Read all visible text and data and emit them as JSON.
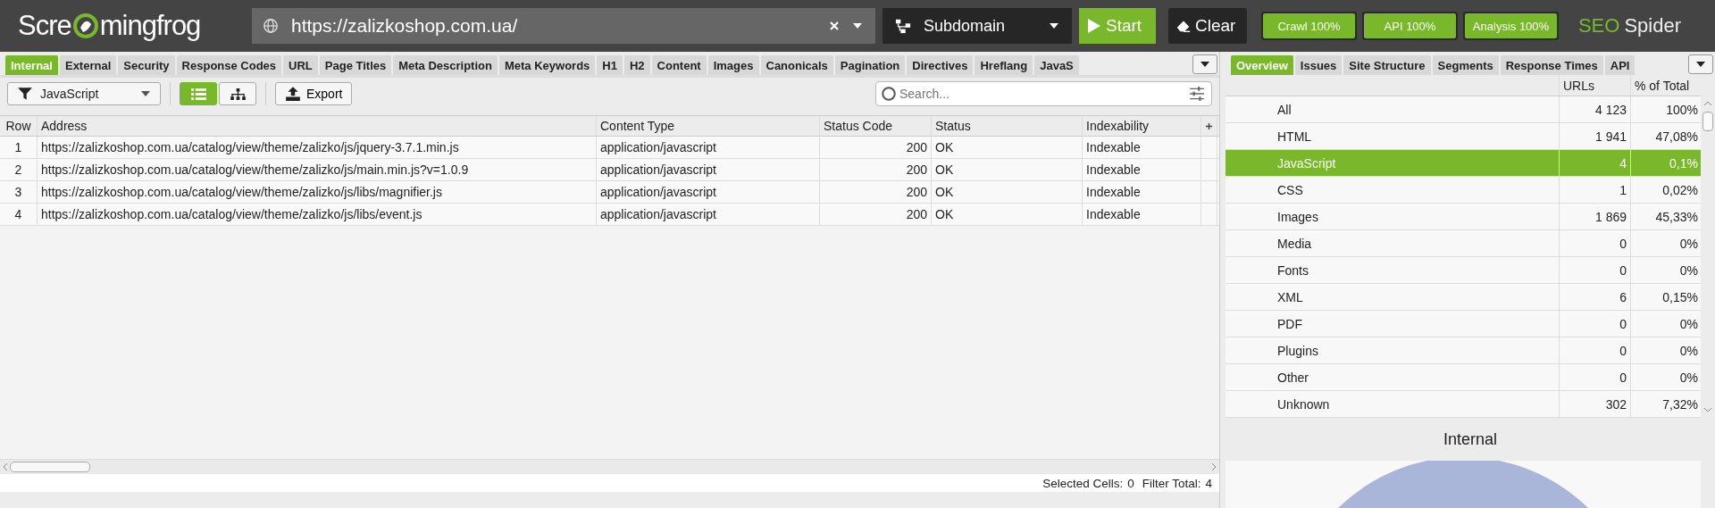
{
  "top_bar": {
    "logo": {
      "left": "Scre",
      "right": "mingfrog"
    },
    "url_field": {
      "value": "https://zalizkoshop.com.ua/"
    },
    "mode_dropdown": {
      "value": "Subdomain"
    },
    "start_button": "Start",
    "clear_button": "Clear",
    "progress": [
      {
        "label": "Crawl 100%",
        "level": 1
      },
      {
        "label": "API 100%",
        "level": 1
      },
      {
        "label": "Analysis 100%",
        "level": 1
      }
    ],
    "brand": {
      "first": "SEO",
      "second": "Spider"
    }
  },
  "left_tabs": [
    {
      "label": "Internal",
      "selected": true
    },
    {
      "label": "External",
      "selected": false
    },
    {
      "label": "Security",
      "selected": false
    },
    {
      "label": "Response Codes",
      "selected": false
    },
    {
      "label": "URL",
      "selected": false
    },
    {
      "label": "Page Titles",
      "selected": false
    },
    {
      "label": "Meta Description",
      "selected": false
    },
    {
      "label": "Meta Keywords",
      "selected": false
    },
    {
      "label": "H1",
      "selected": false
    },
    {
      "label": "H2",
      "selected": false
    },
    {
      "label": "Content",
      "selected": false
    },
    {
      "label": "Images",
      "selected": false
    },
    {
      "label": "Canonicals",
      "selected": false
    },
    {
      "label": "Pagination",
      "selected": false
    },
    {
      "label": "Directives",
      "selected": false
    },
    {
      "label": "Hreflang",
      "selected": false
    },
    {
      "label": "JavaS",
      "selected": false
    }
  ],
  "toolbar": {
    "filter": "JavaScript",
    "views": [
      {
        "kind": "list",
        "selected": true
      },
      {
        "kind": "tree",
        "selected": false
      }
    ],
    "export_button": "Export",
    "search": {
      "placeholder": "Search..."
    }
  },
  "table": {
    "columns": [
      "Row",
      "Address",
      "Content Type",
      "Status Code",
      "Status",
      "Indexability"
    ],
    "rows": [
      [
        "1",
        "https://zalizkoshop.com.ua/catalog/view/theme/zalizko/js/jquery-3.7.1.min.js",
        "application/javascript",
        "200",
        "OK",
        "Indexable"
      ],
      [
        "2",
        "https://zalizkoshop.com.ua/catalog/view/theme/zalizko/js/main.min.js?v=1.0.9",
        "application/javascript",
        "200",
        "OK",
        "Indexable"
      ],
      [
        "3",
        "https://zalizkoshop.com.ua/catalog/view/theme/zalizko/js/libs/magnifier.js",
        "application/javascript",
        "200",
        "OK",
        "Indexable"
      ],
      [
        "4",
        "https://zalizkoshop.com.ua/catalog/view/theme/zalizko/js/libs/event.js",
        "application/javascript",
        "200",
        "OK",
        "Indexable"
      ]
    ]
  },
  "status_bar": {
    "selected_label": "Selected Cells:",
    "selected_value": "0",
    "filter_label": "Filter Total:",
    "filter_value": "4"
  },
  "right_tabs": [
    {
      "label": "Overview",
      "selected": true
    },
    {
      "label": "Issues",
      "selected": false
    },
    {
      "label": "Site Structure",
      "selected": false
    },
    {
      "label": "Segments",
      "selected": false
    },
    {
      "label": "Response Times",
      "selected": false
    },
    {
      "label": "API",
      "selected": false
    }
  ],
  "overview": {
    "columns": [
      "URLs",
      "% of Total"
    ],
    "rows": [
      {
        "label": "All",
        "urls": "4 123",
        "percent": "100%",
        "selected": false
      },
      {
        "label": "HTML",
        "urls": "1 941",
        "percent": "47,08%",
        "selected": false
      },
      {
        "label": "JavaScript",
        "urls": "4",
        "percent": "0,1%",
        "selected": true
      },
      {
        "label": "CSS",
        "urls": "1",
        "percent": "0,02%",
        "selected": false
      },
      {
        "label": "Images",
        "urls": "1 869",
        "percent": "45,33%",
        "selected": false
      },
      {
        "label": "Media",
        "urls": "0",
        "percent": "0%",
        "selected": false
      },
      {
        "label": "Fonts",
        "urls": "0",
        "percent": "0%",
        "selected": false
      },
      {
        "label": "XML",
        "urls": "6",
        "percent": "0,15%",
        "selected": false
      },
      {
        "label": "PDF",
        "urls": "0",
        "percent": "0%",
        "selected": false
      },
      {
        "label": "Plugins",
        "urls": "0",
        "percent": "0%",
        "selected": false
      },
      {
        "label": "Other",
        "urls": "0",
        "percent": "0%",
        "selected": false
      },
      {
        "label": "Unknown",
        "urls": "302",
        "percent": "7,32%",
        "selected": false
      }
    ]
  },
  "chart_panel": {
    "title": "Internal"
  }
}
